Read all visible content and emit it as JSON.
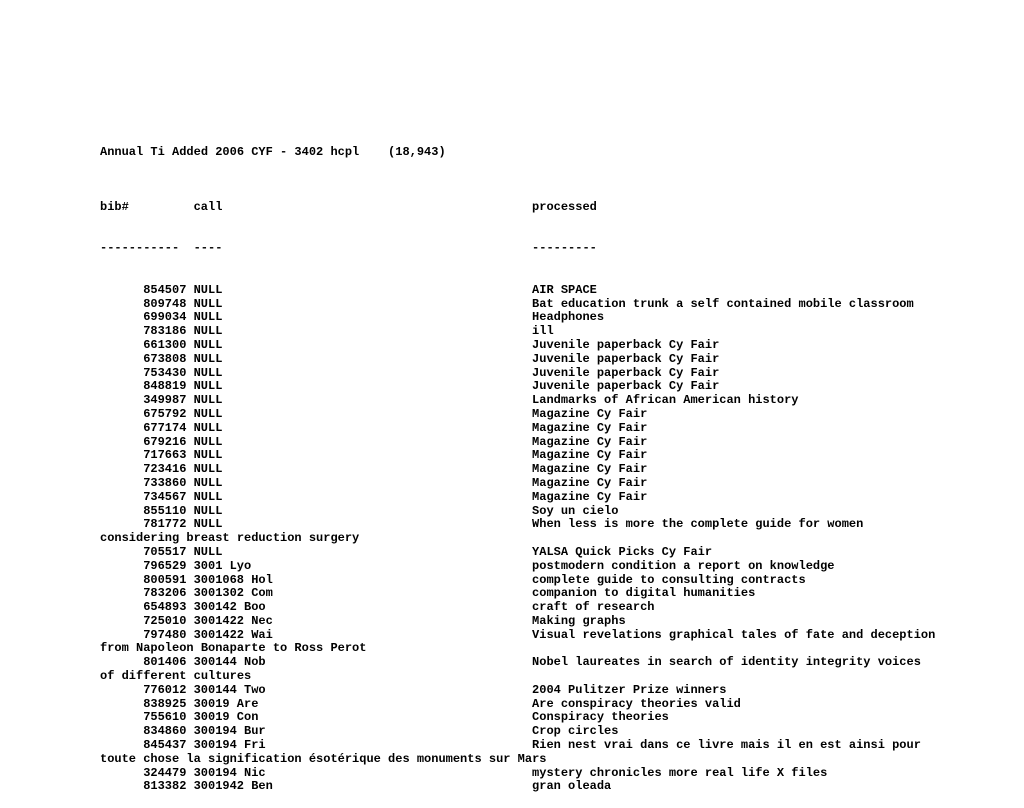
{
  "title": "Annual Ti Added 2006 CYF - 3402 hcpl    (18,943)",
  "headers": {
    "bib": "bib#",
    "call": "call",
    "processed": "processed"
  },
  "rules": {
    "bib": "-----------",
    "call": "----",
    "processed": "---------"
  },
  "rows": [
    {
      "bib": "854507",
      "call": "NULL",
      "processed": "AIR SPACE"
    },
    {
      "bib": "809748",
      "call": "NULL",
      "processed": "Bat education trunk a self contained mobile classroom"
    },
    {
      "bib": "699034",
      "call": "NULL",
      "processed": "Headphones"
    },
    {
      "bib": "783186",
      "call": "NULL",
      "processed": "ill"
    },
    {
      "bib": "661300",
      "call": "NULL",
      "processed": "Juvenile paperback Cy Fair"
    },
    {
      "bib": "673808",
      "call": "NULL",
      "processed": "Juvenile paperback Cy Fair"
    },
    {
      "bib": "753430",
      "call": "NULL",
      "processed": "Juvenile paperback Cy Fair"
    },
    {
      "bib": "848819",
      "call": "NULL",
      "processed": "Juvenile paperback Cy Fair"
    },
    {
      "bib": "349987",
      "call": "NULL",
      "processed": "Landmarks of African American history"
    },
    {
      "bib": "675792",
      "call": "NULL",
      "processed": "Magazine Cy Fair"
    },
    {
      "bib": "677174",
      "call": "NULL",
      "processed": "Magazine Cy Fair"
    },
    {
      "bib": "679216",
      "call": "NULL",
      "processed": "Magazine Cy Fair"
    },
    {
      "bib": "717663",
      "call": "NULL",
      "processed": "Magazine Cy Fair"
    },
    {
      "bib": "723416",
      "call": "NULL",
      "processed": "Magazine Cy Fair"
    },
    {
      "bib": "733860",
      "call": "NULL",
      "processed": "Magazine Cy Fair"
    },
    {
      "bib": "734567",
      "call": "NULL",
      "processed": "Magazine Cy Fair"
    },
    {
      "bib": "855110",
      "call": "NULL",
      "processed": "Soy un cielo"
    },
    {
      "bib": "781772",
      "call": "NULL",
      "processed": "When less is more the complete guide for women",
      "wrap": "considering breast reduction surgery"
    },
    {
      "bib": "705517",
      "call": "NULL",
      "processed": "YALSA Quick Picks Cy Fair"
    },
    {
      "bib": "796529",
      "call": "3001 Lyo",
      "processed": "postmodern condition a report on knowledge"
    },
    {
      "bib": "800591",
      "call": "3001068 Hol",
      "processed": "complete guide to consulting contracts"
    },
    {
      "bib": "783206",
      "call": "3001302 Com",
      "processed": "companion to digital humanities"
    },
    {
      "bib": "654893",
      "call": "300142 Boo",
      "processed": "craft of research"
    },
    {
      "bib": "725010",
      "call": "3001422 Nec",
      "processed": "Making graphs"
    },
    {
      "bib": "797480",
      "call": "3001422 Wai",
      "processed": "Visual revelations graphical tales of fate and deception",
      "wrap": "from Napoleon Bonaparte to Ross Perot"
    },
    {
      "bib": "801406",
      "call": "300144 Nob",
      "processed": "Nobel laureates in search of identity integrity voices",
      "wrap": "of different cultures"
    },
    {
      "bib": "776012",
      "call": "300144 Two",
      "processed": "2004 Pulitzer Prize winners"
    },
    {
      "bib": "838925",
      "call": "30019 Are",
      "processed": "Are conspiracy theories valid"
    },
    {
      "bib": "755610",
      "call": "30019 Con",
      "processed": "Conspiracy theories"
    },
    {
      "bib": "834860",
      "call": "300194 Bur",
      "processed": "Crop circles"
    },
    {
      "bib": "845437",
      "call": "300194 Fri",
      "processed": "Rien nest vrai dans ce livre mais il en est ainsi pour",
      "wrap": "toute chose la signification ésotérique des monuments sur Mars"
    },
    {
      "bib": "324479",
      "call": "300194 Nic",
      "processed": "mystery chronicles more real life X files"
    },
    {
      "bib": "813382",
      "call": "3001942 Ben",
      "processed": "gran oleada"
    }
  ]
}
